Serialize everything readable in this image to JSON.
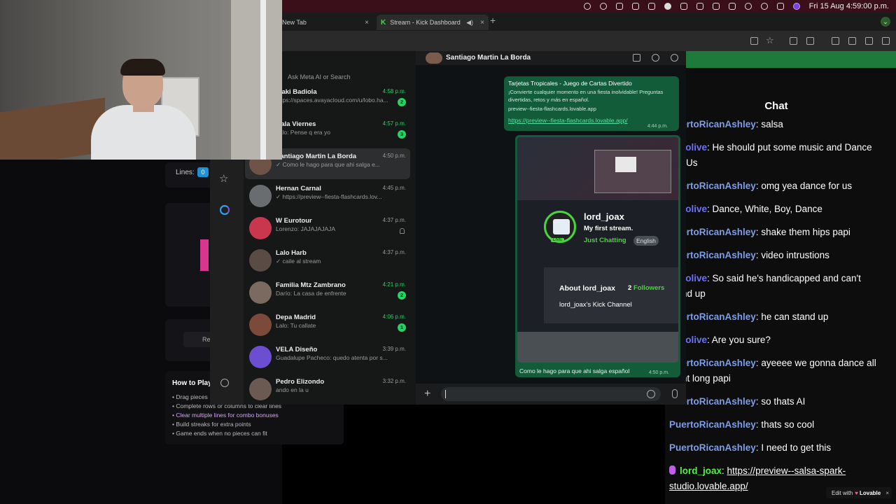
{
  "menubar": {
    "clock": "Fri 15 Aug  4:59:00 p.m."
  },
  "browser": {
    "tabs": [
      {
        "label": "New Tab"
      },
      {
        "label": "Stream - Kick Dashboard"
      }
    ],
    "close_glyph": "×",
    "new_tab_glyph": "+"
  },
  "game": {
    "lines_label": "Lines:",
    "lines_value": "0",
    "button_label": "Re",
    "howto_title": "How to Play",
    "howto_items": [
      "Drag pieces",
      "Complete rows or columns to clear lines",
      "Clear multiple lines for combo bonuses",
      "Build streaks for extra points",
      "Game ends when no pieces can fit"
    ]
  },
  "whatsapp": {
    "search_placeholder": "Ask Meta AI or Search",
    "chats": [
      {
        "name": "Iñaki Badiola",
        "preview": "https://spaces.avayacloud.com/u/lobo.ha...",
        "time": "4:58 p.m.",
        "unread": "2"
      },
      {
        "name": "Gala Viernes",
        "preview": "Lalo: Pense q era yo",
        "time": "4:57 p.m.",
        "unread": "3"
      },
      {
        "name": "Santiago Martin La Borda",
        "preview": "✓ Como le hago para que ahi salga e...",
        "time": "4:50 p.m.",
        "unread": ""
      },
      {
        "name": "Hernan Carnal",
        "preview": "✓ https://preview--fiesta-flashcards.lov...",
        "time": "4:45 p.m.",
        "unread": ""
      },
      {
        "name": "W Eurotour",
        "preview": "Lorenzo: JAJAJAJAJA",
        "time": "4:37 p.m.",
        "unread": ""
      },
      {
        "name": "Lalo Harb",
        "preview": "✓ caile al stream",
        "time": "4:37 p.m.",
        "unread": ""
      },
      {
        "name": "Familia Mtz Zambrano",
        "preview": "Darío: La casa de enfrente",
        "time": "4:21 p.m.",
        "unread": "2"
      },
      {
        "name": "Depa Madrid",
        "preview": "Lalo: Tu callate",
        "time": "4:06 p.m.",
        "unread": "1"
      },
      {
        "name": "VELA Diseño",
        "preview": "Guadalupe Pacheco: quedo atenta por s...",
        "time": "3:39 p.m.",
        "unread": ""
      },
      {
        "name": "Pedro Elizondo",
        "preview": "ando en la u",
        "time": "3:32 p.m.",
        "unread": ""
      }
    ],
    "conversation": {
      "contact": "Santiago Martin La Borda",
      "message1": {
        "title": "Tarjetas Tropicales - Juego de Cartas Divertido",
        "desc": "¡Convierte cualquier momento en una fiesta inolvidable! Preguntas divertidas, retos y más en español.",
        "domain": "preview--fiesta-flashcards.lovable.app",
        "link": "https://preview--fiesta-flashcards.lovable.app/",
        "time": "4:44 p.m."
      },
      "message2": {
        "stream_name": "lord_joax",
        "stream_title": "My first stream.",
        "category": "Just Chatting",
        "language": "English",
        "live": "LIVE",
        "about": "About lord_joax",
        "followers_count": "2",
        "followers_label": "Followers",
        "channel": "lord_joax's Kick Channel",
        "caption": "Como le hago para que ahi salga español",
        "time": "4:50 p.m."
      }
    }
  },
  "kick_chat": {
    "title": "Chat",
    "messages": [
      {
        "user": "PuertoRicanAshley",
        "role": "pr",
        "text": "salsa"
      },
      {
        "user": "yagolive",
        "role": "ya",
        "text": "He should put some music and Dance For Us"
      },
      {
        "user": "PuertoRicanAshley",
        "role": "pr",
        "text": "omg yea dance for us"
      },
      {
        "user": "yagolive",
        "role": "ya",
        "text": "Dance, White, Boy, Dance"
      },
      {
        "user": "PuertoRicanAshley",
        "role": "pr",
        "text": "shake them hips papi"
      },
      {
        "user": "PuertoRicanAshley",
        "role": "pr",
        "text": "video intrustions"
      },
      {
        "user": "yagolive",
        "role": "ya",
        "text": "So said he's handicapped and can't stand up"
      },
      {
        "user": "PuertoRicanAshley",
        "role": "pr",
        "text": "he can stand up"
      },
      {
        "user": "yagolive",
        "role": "ya",
        "text": "Are you sure?"
      },
      {
        "user": "PuertoRicanAshley",
        "role": "pr",
        "text": "ayeeee we gonna dance all night long papi"
      },
      {
        "user": "PuertoRicanAshley",
        "role": "pr",
        "text": "so thats AI"
      },
      {
        "user": "PuertoRicanAshley",
        "role": "pr",
        "text": "thats so cool"
      },
      {
        "user": "PuertoRicanAshley",
        "role": "pr",
        "text": "I need to get this"
      }
    ],
    "last_message": {
      "user": "lord_joax",
      "link": "https://preview--salsa-spark-studio.lovable.app/"
    }
  },
  "lovable": {
    "prefix": "Edit with",
    "brand": "Lovable",
    "close": "×"
  },
  "colors": {
    "kick_green": "#53ee4a",
    "whatsapp_green": "#26d367",
    "bubble_green": "#135c3a",
    "chat_user_ashley": "#7c9ee8",
    "chat_user_yago": "#6b72ff"
  }
}
